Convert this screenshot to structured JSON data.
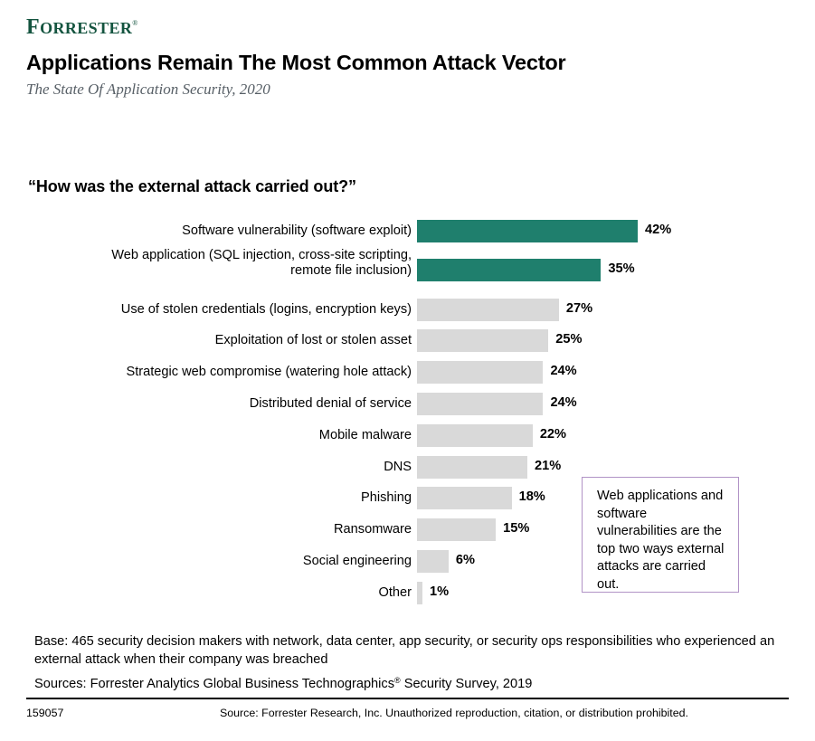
{
  "brand": {
    "name_first_letter": "F",
    "name_rest": "ORRESTER",
    "registered_mark": "®"
  },
  "header": {
    "title": "Applications Remain The Most Common Attack Vector",
    "subtitle": "The State Of Application Security, 2020"
  },
  "question": "“How was the external attack carried out?”",
  "callout": {
    "text": "Web applications and software vulnerabilities are the top two ways external attacks are carried out.",
    "border_color": "#b193c6"
  },
  "notes": {
    "base": "Base: 465 security decision makers with network, data center, app security, or security ops responsibilities who experienced an external attack when their company was breached",
    "sources_prefix": "Sources: Forrester Analytics Global Business Technographics",
    "sources_mark": "®",
    "sources_suffix": " Security Survey, 2019"
  },
  "footer": {
    "doc_id": "159057",
    "source": "Source: Forrester Research, Inc. Unauthorized reproduction, citation, or distribution prohibited."
  },
  "chart_data": {
    "type": "bar",
    "orientation": "horizontal",
    "title": "Applications Remain The Most Common Attack Vector",
    "subtitle": "The State Of Application Security, 2020",
    "question": "“How was the external attack carried out?”",
    "xlabel": "",
    "ylabel": "",
    "xlim": [
      0,
      45
    ],
    "grid": false,
    "legend": "none",
    "value_suffix": "%",
    "highlight_color": "#1f7f6d",
    "base_color": "#d9d9d9",
    "categories": [
      "Software vulnerability (software exploit)",
      "Web application (SQL injection, cross-site scripting,\nremote file inclusion)",
      "Use of stolen credentials (logins, encryption keys)",
      "Exploitation of lost or stolen asset",
      "Strategic web compromise (watering hole attack)",
      "Distributed denial of service",
      "Mobile malware",
      "DNS",
      "Phishing",
      "Ransomware",
      "Social engineering",
      "Other"
    ],
    "values": [
      42,
      35,
      27,
      25,
      24,
      24,
      22,
      21,
      18,
      15,
      6,
      1
    ],
    "value_labels": [
      "42%",
      "35%",
      "27%",
      "25%",
      "24%",
      "24%",
      "22%",
      "21%",
      "18%",
      "15%",
      "6%",
      "1%"
    ],
    "highlighted": [
      true,
      true,
      false,
      false,
      false,
      false,
      false,
      false,
      false,
      false,
      false,
      false
    ]
  }
}
